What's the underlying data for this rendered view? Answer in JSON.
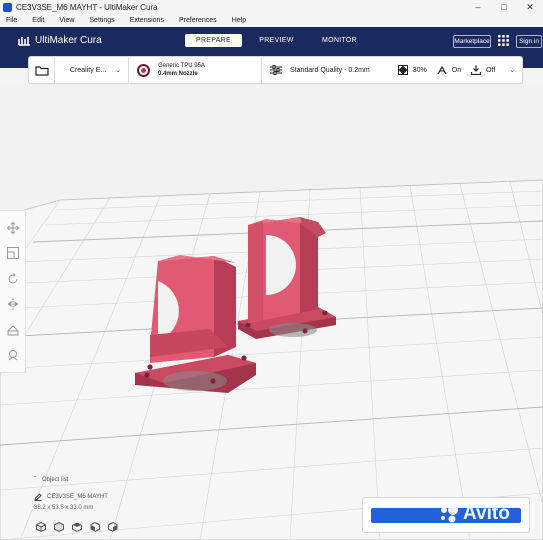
{
  "window": {
    "title": "CE3V3SE_M6 MAYHT - UltiMaker Cura",
    "icon": "cura-app-icon",
    "controls": [
      "minimize",
      "maximize",
      "close"
    ]
  },
  "menu": [
    "File",
    "Edit",
    "View",
    "Settings",
    "Extensions",
    "Preferences",
    "Help"
  ],
  "header": {
    "logo": "UltiMaker Cura",
    "tabs": [
      {
        "label": "PREPARE",
        "active": true
      },
      {
        "label": "PREVIEW",
        "active": false
      },
      {
        "label": "MONITOR",
        "active": false
      }
    ],
    "marketplace": "Marketplace",
    "signin": "Sign in",
    "colors": {
      "header_bg": "#1b2a5e",
      "accent": "#2361d8"
    }
  },
  "toolbar": {
    "printer": "Creality E...",
    "material": {
      "name": "Generic TPU 95A",
      "nozzle": "0.4mm Nozzle",
      "color": "#b23a4c"
    },
    "quality": "Standard Quality - 0.2mm",
    "infill": "30%",
    "support": "On",
    "adhesion": "Off"
  },
  "object": {
    "list_label": "Object list",
    "name": "CE3V3SE_M6 MAYHT",
    "dimensions": "38.2 x 53.5 x 33.0 mm"
  },
  "watermark": "Avito"
}
